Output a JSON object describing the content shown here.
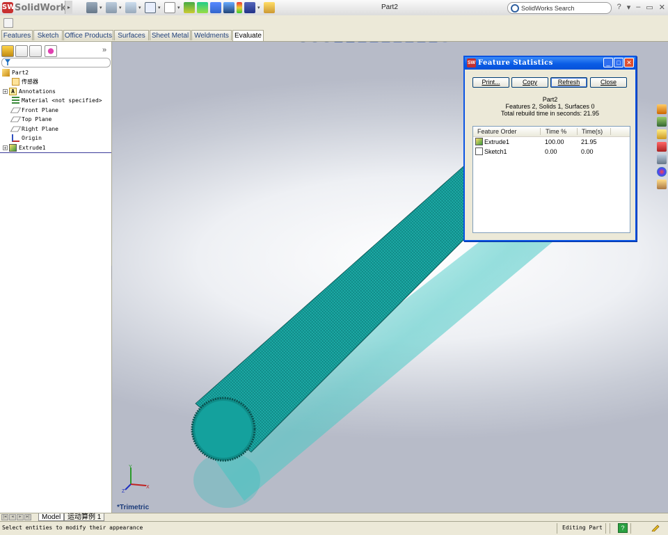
{
  "app": {
    "brand": "SolidWorks",
    "document_title": "Part2",
    "search_placeholder": "SolidWorks Search",
    "window_controls": [
      "?",
      "▾",
      "–",
      "▭",
      "✕"
    ]
  },
  "command_tabs": [
    "Features",
    "Sketch",
    "Office Products",
    "Surfaces",
    "Sheet Metal",
    "Weldments",
    "Evaluate"
  ],
  "active_tab": "Evaluate",
  "feature_tree": {
    "root": "Part2",
    "items": [
      {
        "label": "传感器",
        "icon": "sensor-icon",
        "expandable": false
      },
      {
        "label": "Annotations",
        "icon": "annotations-icon",
        "expandable": true
      },
      {
        "label": "Material <not specified>",
        "icon": "material-icon",
        "expandable": false
      },
      {
        "label": "Front Plane",
        "icon": "plane-icon",
        "expandable": false
      },
      {
        "label": "Top Plane",
        "icon": "plane-icon",
        "expandable": false
      },
      {
        "label": "Right Plane",
        "icon": "plane-icon",
        "expandable": false
      },
      {
        "label": "Origin",
        "icon": "origin-icon",
        "expandable": false
      },
      {
        "label": "Extrude1",
        "icon": "extrude-icon",
        "expandable": true
      }
    ],
    "expand_label": "»"
  },
  "viewport": {
    "view_label": "*Trimetric",
    "axes": {
      "x": "X",
      "y": "Y",
      "z": "Z"
    }
  },
  "dialog": {
    "title": "Feature Statistics",
    "buttons": [
      "Print...",
      "Copy",
      "Refresh",
      "Close"
    ],
    "part_name": "Part2",
    "summary": "Features 2, Solids 1, Surfaces 0",
    "rebuild": "Total rebuild time in seconds: 21.95",
    "columns": [
      "Feature Order",
      "Time %",
      "Time(s)"
    ],
    "rows": [
      {
        "feature": "Extrude1",
        "pct": "100.00",
        "time": "21.95",
        "icon": "extrude-icon"
      },
      {
        "feature": "Sketch1",
        "pct": "0.00",
        "time": "0.00",
        "icon": "sketch-icon"
      }
    ]
  },
  "bottom_tabs": [
    "Model",
    "运动算例 1"
  ],
  "status": {
    "message": "Select entities to modify their appearance",
    "mode": "Editing Part",
    "help_label": "?"
  },
  "colors": {
    "part_teal": "#1aa9a6",
    "dialog_title": "#0a5ce6",
    "tab_text": "#1f3f7a"
  }
}
